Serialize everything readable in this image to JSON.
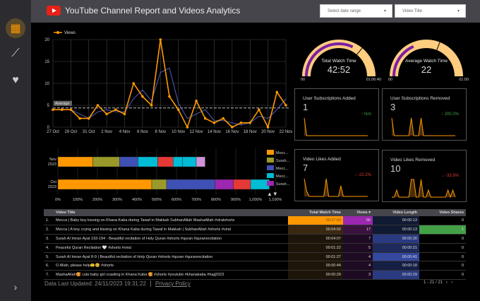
{
  "header": {
    "title": "YouTube Channel Report and Videos Analytics",
    "date_range_placeholder": "Select date range",
    "video_title_filter": "Video Title"
  },
  "sidebar": {
    "items": [
      {
        "icon": "dashboard-icon",
        "active": true
      },
      {
        "icon": "trend-icon"
      },
      {
        "icon": "heart-icon"
      }
    ],
    "expand_icon": "chevron-right-icon"
  },
  "colors": {
    "orange": "#ff9800",
    "purple": "#7b1fa2",
    "gauge_bg": "#ffcc80",
    "up": "#43a047",
    "down": "#e53935"
  },
  "chart_data": [
    {
      "type": "line",
      "legend": [
        "Views"
      ],
      "average_label": "Average",
      "ylim": [
        0,
        20
      ],
      "yticks": [
        0,
        5,
        10,
        15,
        20
      ],
      "x": [
        "27 Oct",
        "28 Oct",
        "29 Oct",
        "30 Oct",
        "31 Oct",
        "1 Nov",
        "2 Nov",
        "3 Nov",
        "4 Nov",
        "5 Nov",
        "6 Nov",
        "7 Nov",
        "8 Nov",
        "9 Nov",
        "10 Nov",
        "11 Nov",
        "12 Nov",
        "13 Nov",
        "14 Nov",
        "15 Nov",
        "16 Nov",
        "17 Nov",
        "18 Nov",
        "19 Nov",
        "20 Nov",
        "21 Nov",
        "22 Nov"
      ],
      "xticks": [
        "27 Oct",
        "29 Oct",
        "31 Oct",
        "2 Nov",
        "4 Nov",
        "6 Nov",
        "8 Nov",
        "10 Nov",
        "12 Nov",
        "14 Nov",
        "16 Nov",
        "18 Nov",
        "20 Nov",
        "22 Nov"
      ],
      "series": [
        {
          "name": "Views",
          "values": [
            4,
            4,
            4,
            2,
            2,
            5,
            3,
            4,
            3,
            10,
            7,
            5,
            20,
            7,
            4,
            0,
            6,
            2,
            1,
            2,
            0,
            1,
            1,
            4,
            0,
            8,
            5
          ]
        },
        {
          "values": [
            4,
            4,
            4,
            3,
            2,
            3.5,
            4,
            3.5,
            3.5,
            6.5,
            8.5,
            6,
            12.5,
            13.5,
            5.5,
            2,
            3,
            4,
            1.5,
            1.5,
            1,
            0.5,
            1,
            2.5,
            2,
            4,
            6.5
          ]
        }
      ],
      "average": 4.4
    },
    {
      "type": "bar",
      "stacked": true,
      "orientation": "horizontal",
      "categories": [
        "Nov 2023",
        "Oct 2023"
      ],
      "xticks": [
        "0%",
        "100%",
        "200%",
        "300%",
        "400%",
        "500%",
        "600%",
        "700%",
        "800%",
        "900%",
        "1,000%",
        "1,100%"
      ],
      "xlim": [
        0,
        1100
      ],
      "legend": [
        "Mecc...",
        "Surah...",
        "Mecc...",
        "Mecc...",
        "Surah..."
      ],
      "segments": [
        [
          {
            "v": 177,
            "c": "#ff9800"
          },
          {
            "v": 135,
            "c": "#9a9a2a"
          },
          {
            "v": 93,
            "c": "#3f51b5"
          },
          {
            "v": 100,
            "c": "#00bcd4"
          },
          {
            "v": 78,
            "c": "#e53935"
          },
          {
            "v": 47,
            "c": "#00bcd4"
          },
          {
            "v": 70,
            "c": "#00bcd4"
          },
          {
            "v": 45,
            "c": "#ce93d8"
          }
        ],
        [
          {
            "v": 475,
            "c": "#ff9800"
          },
          {
            "v": 75,
            "c": "#9a9a2a"
          },
          {
            "v": 245,
            "c": "#3f51b5"
          },
          {
            "v": 93,
            "c": "#9c27b0"
          },
          {
            "v": 87,
            "c": "#e53935"
          },
          {
            "v": 95,
            "c": "#00bcd4"
          }
        ]
      ],
      "legend_colors": [
        "#ff9800",
        "#9a9a2a",
        "#3f51b5",
        "#00bcd4",
        "#9c27b0"
      ]
    }
  ],
  "gauges": [
    {
      "label": "Total Watch Time",
      "value": "42:52",
      "min": "00",
      "max": "01:06:40",
      "fill": 0.64,
      "target": 0.72
    },
    {
      "label": "Average Watch Time",
      "value": "22",
      "min": "00",
      "max": "01:00",
      "fill": 0.37,
      "target": 0.62
    }
  ],
  "cards": [
    {
      "title": "User Subscriptions Added",
      "value": "1",
      "delta": "↑ N/A",
      "dir": "up",
      "spark": [
        10,
        0,
        0,
        0,
        0,
        0,
        0,
        0,
        0,
        0,
        0,
        0,
        0,
        0,
        0,
        0,
        0,
        0,
        0,
        0,
        0,
        0,
        0,
        0,
        0,
        0,
        0
      ]
    },
    {
      "title": "User Subscriptions Removed",
      "value": "3",
      "delta": "↑ 200.0%",
      "dir": "up",
      "spark": [
        10,
        0,
        0,
        0,
        0,
        0,
        0,
        0,
        10,
        0,
        0,
        0,
        10,
        0,
        0,
        0,
        0,
        0,
        0,
        0,
        0,
        0,
        0,
        0,
        0,
        0,
        0
      ]
    },
    {
      "title": "Video Likes Added",
      "value": "7",
      "delta": "↓ -22.2%",
      "dir": "down",
      "spark": [
        10,
        3,
        0,
        0,
        0,
        0,
        0,
        0,
        0,
        10,
        0,
        0,
        0,
        0,
        0,
        6,
        0,
        0,
        0,
        0,
        0,
        0,
        0,
        0,
        0,
        0,
        0
      ]
    },
    {
      "title": "Video Likes Removed",
      "value": "10",
      "delta": "↓ -33.3%",
      "dir": "down",
      "spark": [
        0,
        0,
        4,
        0,
        0,
        0,
        0,
        0,
        10,
        10,
        0,
        0,
        10,
        0,
        0,
        4,
        0,
        0,
        0,
        0,
        0,
        0,
        0,
        4,
        0,
        4,
        0
      ]
    }
  ],
  "table": {
    "headers": [
      "",
      "Video Title",
      "Total Watch Time",
      "Views ▾",
      "Video Length",
      "Video Shares"
    ],
    "rows": [
      [
        "1.",
        "Mecca | Baby boy kissing on Khana Kaba during Tawaf in Makkah SubhanAllah MashaAllah #viralshorts",
        "00:27:00",
        "66",
        "00:00:13",
        "0"
      ],
      [
        "2.",
        "Mecca | A boy crying and kissing on Khana Kaba during Tawaf in Makkah | SubhanAllah #shorts #viral",
        "00:04:02",
        "17",
        "00:00:13",
        "1"
      ],
      [
        "3.",
        "Surah Al Imran Ayat 193-194 - Beautiful recitation of Holy Quran #shorts #quran #quranrecitation",
        "00:04:07",
        "7",
        "00:00:30",
        "0"
      ],
      [
        "4.",
        "Peaceful Quran Recitation 🤍 #shorts #viral",
        "00:01:22",
        "5",
        "00:00:21",
        "0"
      ],
      [
        "5.",
        "Surah Al Imran Ayat 8-9 | Beautiful recitation of Holy Quran #shorts #quran #quranrecitation",
        "00:01:27",
        "4",
        "00:00:41",
        "0"
      ],
      [
        "6.",
        "O Allah, please help🤲😢 #shorts",
        "00:00:44",
        "4",
        "00:00:18",
        "0"
      ],
      [
        "7.",
        "MashaAllah🥰 cute baby girl crawling in Khana Kaba 🥰 #shorts #youtube #khanakaba #hajj2023",
        "00:00:29",
        "3",
        "00:00:29",
        "0"
      ]
    ]
  },
  "footer": {
    "updated": "Data Last Updated: 24/11/2023 19:31:22",
    "privacy": "Privacy Policy",
    "pager": "1 - 21 / 21",
    "prev": "‹",
    "next": "›"
  }
}
